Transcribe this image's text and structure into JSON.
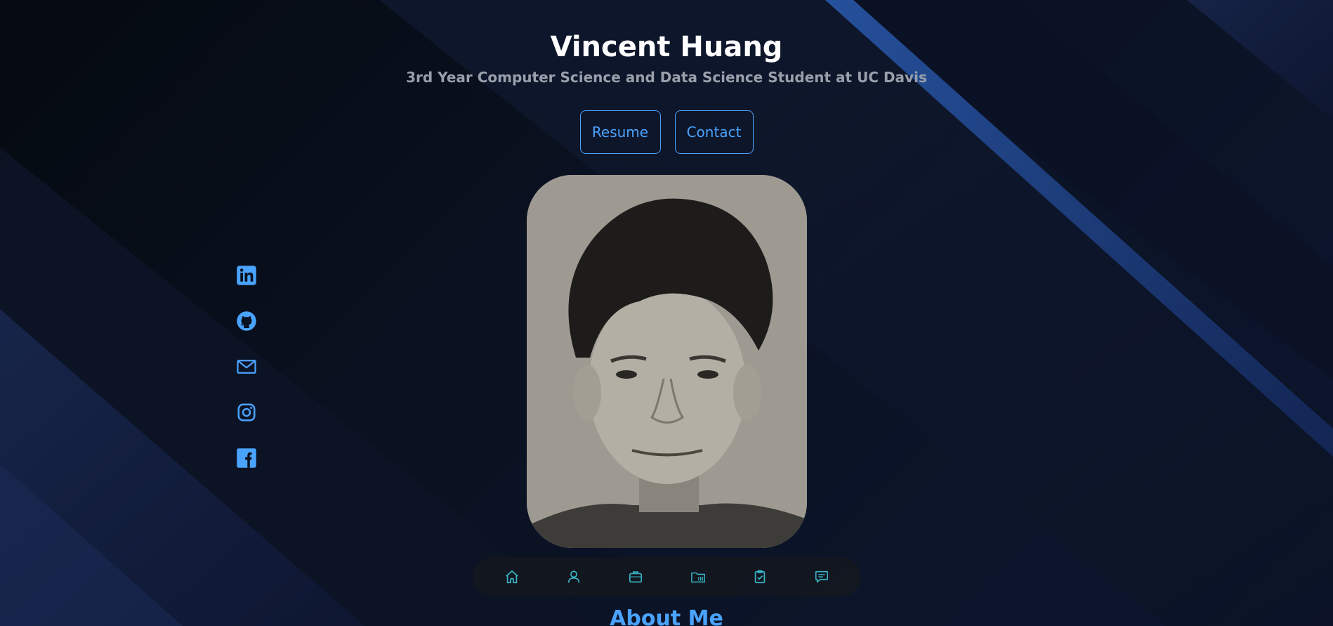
{
  "header": {
    "name": "Vincent Huang",
    "subtitle": "3rd Year Computer Science and Data Science Student at UC Davis"
  },
  "buttons": {
    "resume_label": "Resume",
    "contact_label": "Contact"
  },
  "colors": {
    "accent": "#4aa3ff",
    "nav_icon": "#38b6c8",
    "background": "#070d15"
  },
  "socials": [
    {
      "icon": "linkedin-icon"
    },
    {
      "icon": "github-icon"
    },
    {
      "icon": "mail-icon"
    },
    {
      "icon": "instagram-icon"
    },
    {
      "icon": "facebook-icon"
    }
  ],
  "nav": [
    {
      "icon": "home-icon"
    },
    {
      "icon": "user-icon"
    },
    {
      "icon": "briefcase-icon"
    },
    {
      "icon": "folder-icon"
    },
    {
      "icon": "clipboard-check-icon"
    },
    {
      "icon": "message-icon"
    }
  ],
  "sections": {
    "about_title": "About Me"
  }
}
